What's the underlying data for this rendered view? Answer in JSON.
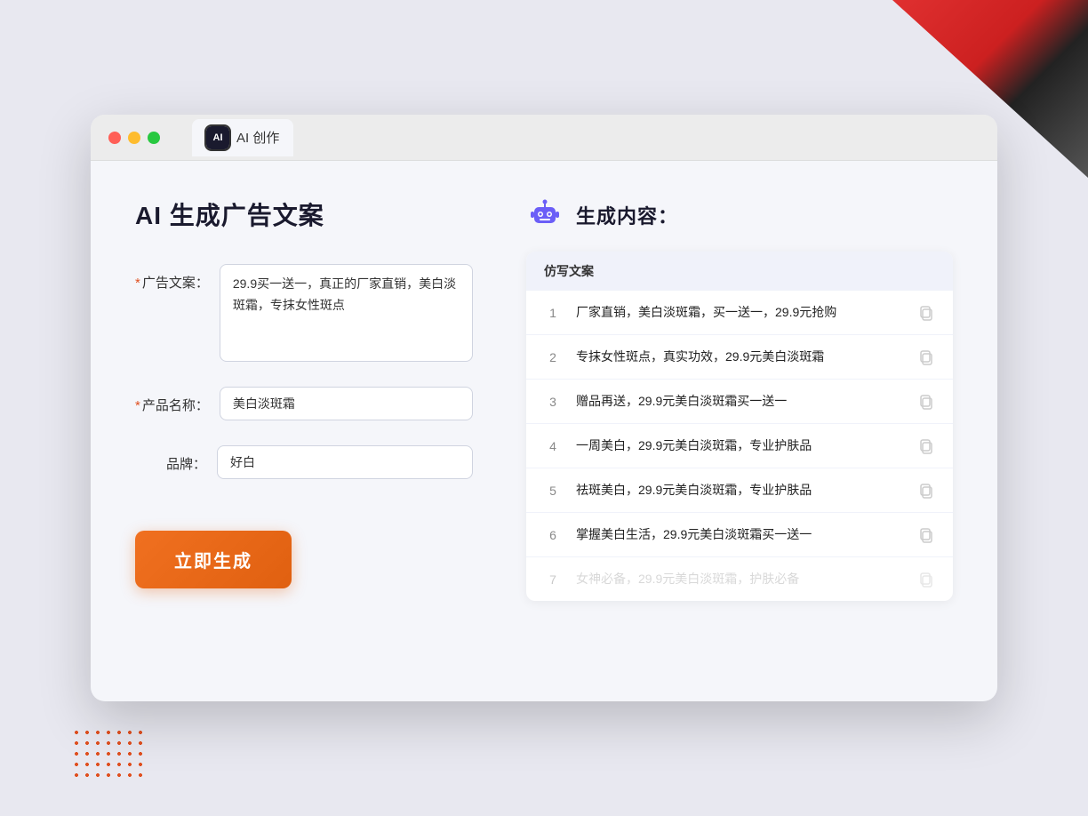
{
  "browser": {
    "tab_label": "AI 创作"
  },
  "page": {
    "title": "AI 生成广告文案",
    "right_title": "生成内容："
  },
  "form": {
    "ad_copy_label": "广告文案：",
    "ad_copy_required": "*",
    "ad_copy_value": "29.9买一送一，真正的厂家直销，美白淡斑霜，专抹女性斑点",
    "product_label": "产品名称：",
    "product_required": "*",
    "product_value": "美白淡斑霜",
    "brand_label": "品牌：",
    "brand_value": "好白",
    "generate_btn": "立即生成"
  },
  "results": {
    "column_header": "仿写文案",
    "items": [
      {
        "num": "1",
        "text": "厂家直销，美白淡斑霜，买一送一，29.9元抢购",
        "faded": false
      },
      {
        "num": "2",
        "text": "专抹女性斑点，真实功效，29.9元美白淡斑霜",
        "faded": false
      },
      {
        "num": "3",
        "text": "赠品再送，29.9元美白淡斑霜买一送一",
        "faded": false
      },
      {
        "num": "4",
        "text": "一周美白，29.9元美白淡斑霜，专业护肤品",
        "faded": false
      },
      {
        "num": "5",
        "text": "祛斑美白，29.9元美白淡斑霜，专业护肤品",
        "faded": false
      },
      {
        "num": "6",
        "text": "掌握美白生活，29.9元美白淡斑霜买一送一",
        "faded": false
      },
      {
        "num": "7",
        "text": "女神必备，29.9元美白淡斑霜，护肤必备",
        "faded": true
      }
    ]
  }
}
